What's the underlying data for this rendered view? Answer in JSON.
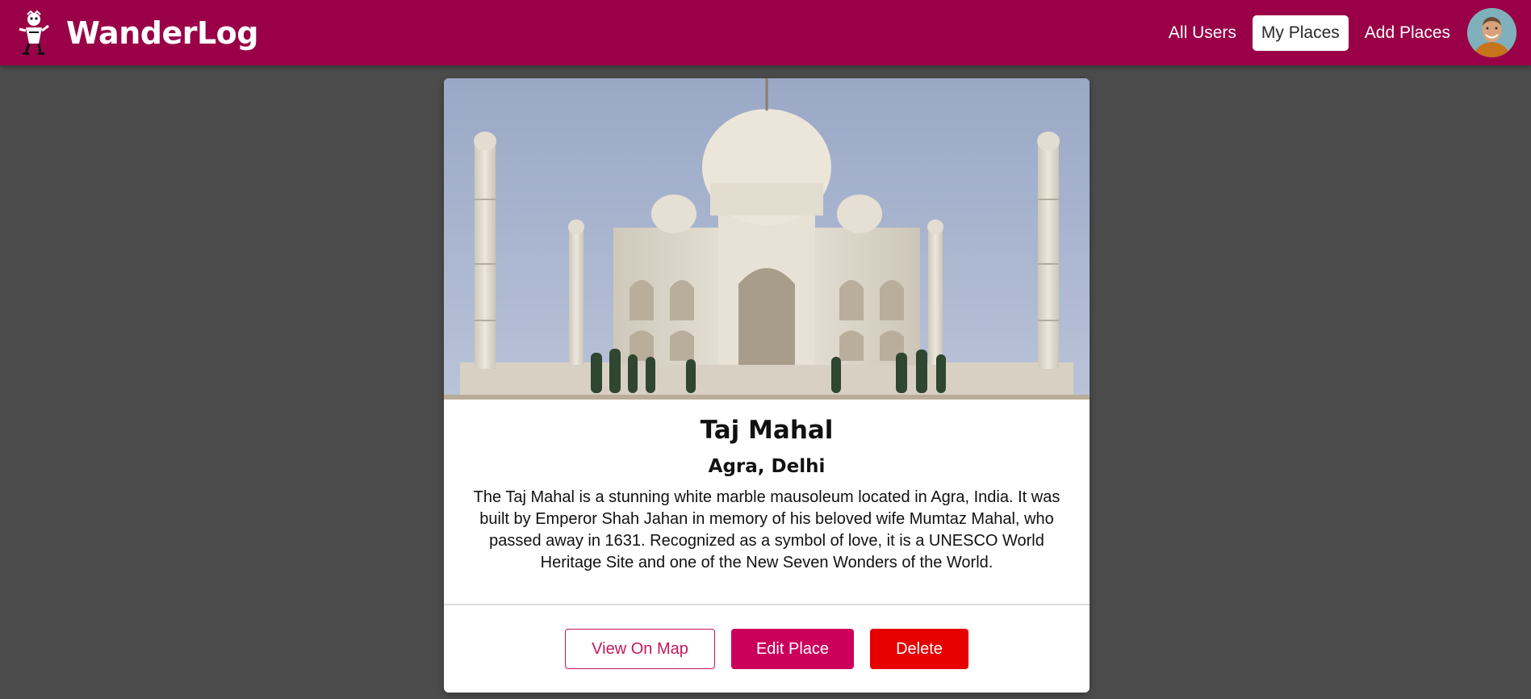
{
  "header": {
    "brand": "WanderLog",
    "logo_icon": "hiker-mascot-icon",
    "nav": [
      {
        "label": "All Users",
        "active": false
      },
      {
        "label": "My Places",
        "active": true
      },
      {
        "label": "Add Places",
        "active": false
      }
    ],
    "avatar_icon": "user-avatar"
  },
  "place": {
    "image_icon": "taj-mahal-photo",
    "title": "Taj Mahal",
    "address": "Agra, Delhi",
    "description": "The Taj Mahal is a stunning white marble mausoleum located in Agra, India. It was built by Emperor Shah Jahan in memory of his beloved wife Mumtaz Mahal, who passed away in 1631. Recognized as a symbol of love, it is a UNESCO World Heritage Site and one of the New Seven Wonders of the World."
  },
  "actions": {
    "view_on_map": "View On Map",
    "edit_place": "Edit Place",
    "delete": "Delete"
  },
  "colors": {
    "header_bg": "#990047",
    "page_bg": "#4b4b4b",
    "primary": "#cc005c",
    "danger": "#e60000"
  }
}
